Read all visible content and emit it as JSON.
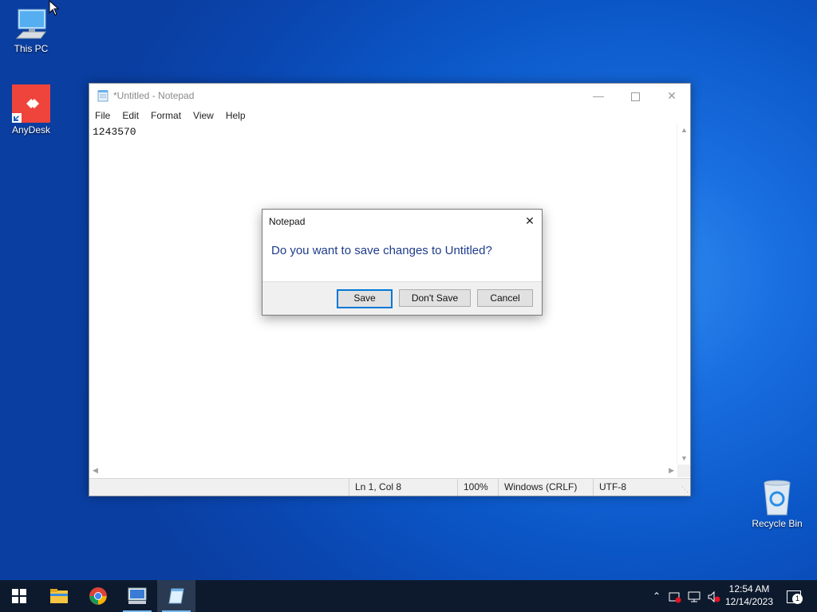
{
  "desktop": {
    "icons": [
      {
        "label": "This PC"
      },
      {
        "label": "AnyDesk"
      },
      {
        "label": "Recycle Bin"
      }
    ]
  },
  "notepad": {
    "title": "*Untitled - Notepad",
    "menu": [
      "File",
      "Edit",
      "Format",
      "View",
      "Help"
    ],
    "content": "1243570",
    "status": {
      "position": "Ln 1, Col 8",
      "zoom": "100%",
      "line_ending": "Windows (CRLF)",
      "encoding": "UTF-8"
    }
  },
  "dialog": {
    "title": "Notepad",
    "message": "Do you want to save changes to Untitled?",
    "buttons": {
      "save": "Save",
      "dont_save": "Don't Save",
      "cancel": "Cancel"
    }
  },
  "taskbar": {
    "apps": [
      {
        "icon": "file-explorer-icon"
      },
      {
        "icon": "chrome-icon"
      },
      {
        "icon": "remote-desktop-icon"
      },
      {
        "icon": "notepad-icon"
      }
    ],
    "clock": {
      "time": "12:54 AM",
      "date": "12/14/2023"
    },
    "notification_count": "1"
  },
  "colors": {
    "accent": "#0078d7",
    "dialog_text": "#1f3c8a",
    "anydesk": "#ef443b"
  }
}
